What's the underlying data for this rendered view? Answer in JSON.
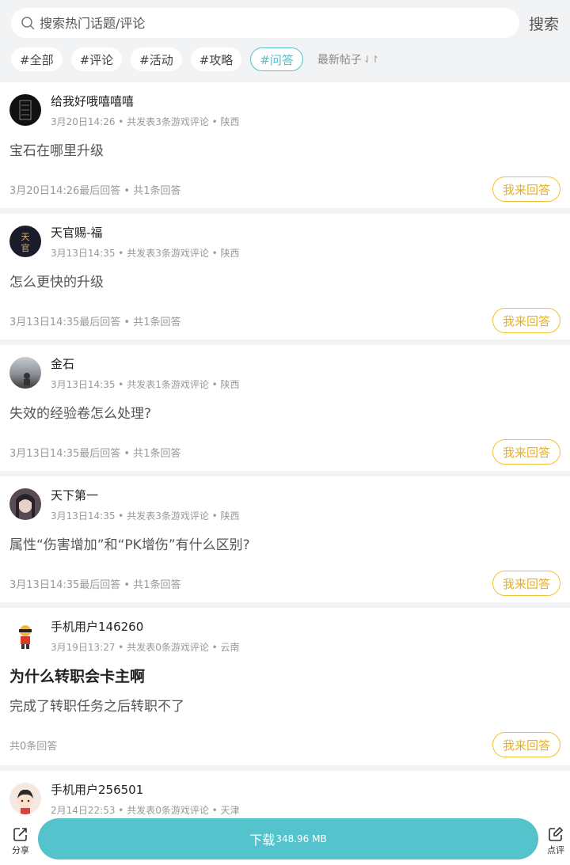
{
  "search": {
    "placeholder": "搜索热门话题/评论",
    "button": "搜索"
  },
  "tags": [
    "#全部",
    "#评论",
    "#活动",
    "#攻略",
    "#问答"
  ],
  "sort_label": "最新帖子",
  "posts": [
    {
      "user": "给我好哦嘻嘻嘻",
      "meta": "3月20日14:26 • 共发表3条游戏评论 • 陕西",
      "title": "",
      "body": "宝石在哪里升级",
      "foot": "3月20日14:26最后回答 • 共1条回答",
      "answer": "我来回答"
    },
    {
      "user": "天官赐-福",
      "meta": "3月13日14:35 • 共发表3条游戏评论 • 陕西",
      "title": "",
      "body": "怎么更快的升级",
      "foot": "3月13日14:35最后回答 • 共1条回答",
      "answer": "我来回答"
    },
    {
      "user": "金石",
      "meta": "3月13日14:35 • 共发表1条游戏评论 • 陕西",
      "title": "",
      "body": "失效的经验卷怎么处理?",
      "foot": "3月13日14:35最后回答 • 共1条回答",
      "answer": "我来回答"
    },
    {
      "user": "天下第一",
      "meta": "3月13日14:35 • 共发表3条游戏评论 • 陕西",
      "title": "",
      "body": "属性“伤害增加”和“PK增伤”有什么区别?",
      "foot": "3月13日14:35最后回答 • 共1条回答",
      "answer": "我来回答"
    },
    {
      "user": "手机用户146260",
      "meta": "3月19日13:27 • 共发表0条游戏评论 • 云南",
      "title": "为什么转职会卡主啊",
      "body": "完成了转职任务之后转职不了",
      "foot": "共0条回答",
      "answer": "我来回答"
    },
    {
      "user": "手机用户256501",
      "meta": "2月14日22:53 • 共发表0条游戏评论 • 天津",
      "title": "",
      "body": "",
      "foot": "",
      "answer": ""
    }
  ],
  "bottom": {
    "share": "分享",
    "download": "下载",
    "size": "348.96 MB",
    "review": "点评"
  },
  "colors": {
    "accent": "#54c3cb",
    "answer": "#e8b020"
  }
}
